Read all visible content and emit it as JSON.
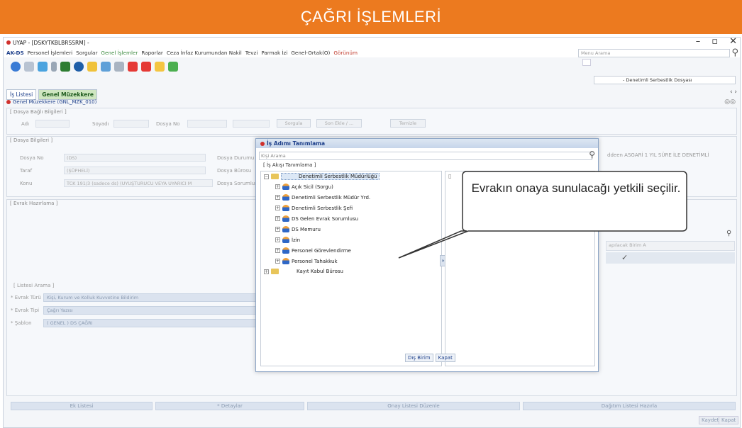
{
  "banner": {
    "title": "ÇAĞRI İŞLEMLERİ"
  },
  "window": {
    "title": "UYAP - [DSKYTKBLBRSSRM] -"
  },
  "menu": [
    "AK-DS",
    "Personel İşlemleri",
    "Sorgular",
    "Genel İşlemler",
    "Raporlar",
    "Ceza İnfaz Kurumundan Nakil",
    "Tevzi",
    "Parmak İzi",
    "Genel-Ortak(O)",
    "Görünüm"
  ],
  "menu_search": {
    "placeholder": "Menu Arama"
  },
  "case_combo": {
    "value": "- Denetimli Serbestlik Dosyası"
  },
  "tabs": [
    "İş Listesi",
    "Genel Müzekkere"
  ],
  "breadcrumb": "Genel Müzekkere (GNL_MZK_010)",
  "section1": {
    "title": "[ Dosya Bağlı Bilgileri ]",
    "ad": "Adı",
    "soyadi": "Soyadı",
    "dosyano": "Dosya No",
    "sorgula": "Sorgula",
    "sonekle": "Son Ekle / ...",
    "temizle": "Temizle"
  },
  "section2": {
    "title": "[ Dosya Bilgileri ]",
    "dosyano_lbl": "Dosya No",
    "dosyano_val": "(DS)",
    "taraf_lbl": "Taraf",
    "taraf_val": "(ŞÜPHELİ)",
    "konu_lbl": "Konu",
    "konu_val": "TCK 191/3 (sadece ds) (UYUŞTURUCU VEYA UYARICI M",
    "durum_lbl": "Dosya Durumu",
    "buro_lbl": "Dosya Bürosu",
    "sorumlu_lbl": "Dosya Sorumlusu",
    "right_text": "ddeen ASGARİ 1 YIL SÜRE İLE DENETİMLİ"
  },
  "section3": {
    "title": "[ Evrak Hazırlama ]",
    "right_text": "apılacak Birim A"
  },
  "section4": {
    "title": "[ Listesi Arama ]",
    "evrak_turu_lbl": "* Evrak Türü",
    "evrak_turu_val": "Kişi, Kurum ve Kolluk Kuvvetine Bildirim",
    "evrak_tipi_lbl": "* Evrak Tipi",
    "evrak_tipi_val": "Çağrı Yazısı",
    "sablon_lbl": "* Şablon",
    "sablon_val": "( GENEL ) DS ÇAĞRI"
  },
  "bottom_tabs": [
    "Ek Listesi",
    "* Detaylar",
    "Onay Listesi Düzenle",
    "Dağıtım Listesi Hazırla"
  ],
  "bottom_buttons": [
    "Kaydet",
    "Kapat"
  ],
  "dialog": {
    "title": "İş Adımı Tanımlama",
    "search_placeholder": "Kişi Arama",
    "legend": "[ İş Akışı Tanımlama ]",
    "tree": {
      "root": "Denetimli Serbestlik Müdürlüğü",
      "children": [
        "Açık Sicil (Sorgu)",
        "Denetimli Serbestlik Müdür Yrd.",
        "Denetimli Serbestlik Şefi",
        "DS Gelen Evrak Sorumlusu",
        "DS Memuru",
        "İzin",
        "Personel Görevlendirme",
        "Personel Tahakkuk"
      ],
      "sibling": "Kayıt Kabul Bürosu"
    },
    "buttons": [
      "Dış Birim",
      "Kapat"
    ]
  },
  "callout": {
    "text": "Evrakın onaya sunulacağı yetkili seçilir."
  },
  "colors": {
    "banner": "#ec7a1f",
    "menu_active": "#3d8b40",
    "tab_active": "#cfe6c1"
  }
}
